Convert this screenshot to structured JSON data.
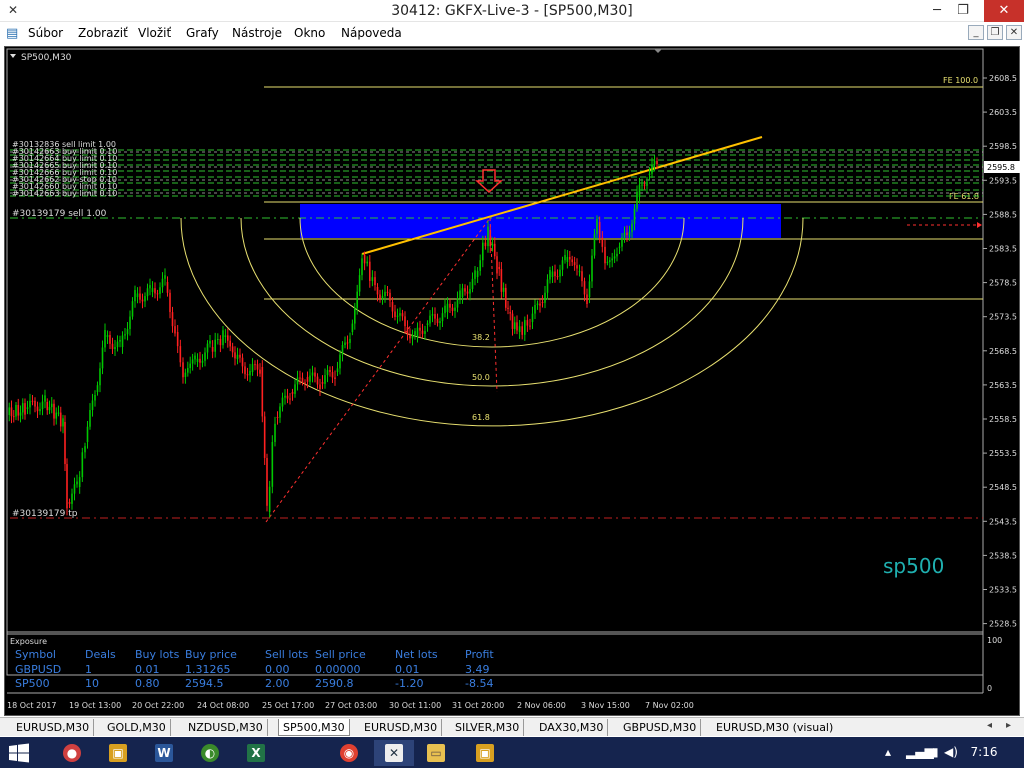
{
  "window": {
    "title": "30412: GKFX-Live-3 - [SP500,M30]",
    "minimize": "─",
    "maximize": "❐",
    "close": "✕"
  },
  "menu": {
    "items": [
      "Súbor",
      "Zobraziť",
      "Vložiť",
      "Grafy",
      "Nástroje",
      "Okno",
      "Nápoveda"
    ]
  },
  "chart": {
    "label": "SP500,M30",
    "watermark": "sp500",
    "price_marker": "2595.8",
    "price_ticks": [
      "2608.5",
      "2603.5",
      "2598.5",
      "2593.5",
      "2588.5",
      "2583.5",
      "2578.5",
      "2573.5",
      "2568.5",
      "2563.5",
      "2558.5",
      "2553.5",
      "2548.5",
      "2543.5",
      "2538.5",
      "2533.5",
      "2528.5"
    ],
    "time_ticks": [
      "18 Oct 2017",
      "19 Oct 13:00",
      "20 Oct 22:00",
      "24 Oct 08:00",
      "25 Oct 17:00",
      "27 Oct 03:00",
      "30 Oct 11:00",
      "31 Oct 20:00",
      "2 Nov 06:00",
      "3 Nov 15:00",
      "7 Nov 02:00"
    ],
    "fib_labels": {
      "fe100": "FE 100.0",
      "fe618": "FE 61.8",
      "arc382": "38.2",
      "arc500": "50.0",
      "arc618": "61.8"
    },
    "order_labels": {
      "sell": "#30139179 sell 1.00",
      "tp": "#30139179 tp",
      "buy_block": [
        "#30132836 sell limit 1.00",
        "#30142663 buy limit 0.10",
        "#30142664 buy limit 0.10",
        "#30142665 buy limit 0.10",
        "#30142666 buy limit 0.10",
        "#30142662 buy stop 0.10",
        "#30142660 buy limit 0.10",
        "#30142663 buy limit 0.10"
      ]
    },
    "colors": {
      "bull": "#00c800",
      "bear": "#ff2020",
      "fib": "#e8e070",
      "trend": "#ffc000",
      "zone": "#0000ff",
      "watermark": "#1fb0b0"
    }
  },
  "exposure": {
    "title": "Exposure",
    "headers": [
      "Symbol",
      "Deals",
      "Buy lots",
      "Buy price",
      "Sell lots",
      "Sell price",
      "Net lots",
      "Profit"
    ],
    "rows": [
      [
        "GBPUSD",
        "1",
        "0.01",
        "1.31265",
        "0.00",
        "0.00000",
        "0.01",
        "3.49"
      ],
      [
        "SP500",
        "10",
        "0.80",
        "2594.5",
        "2.00",
        "2590.8",
        "-1.20",
        "-8.54"
      ]
    ],
    "scale_top": "100",
    "scale_bottom": "0"
  },
  "tabs": [
    "EURUSD,M30",
    "GOLD,M30",
    "NZDUSD,M30",
    "SP500,M30",
    "EURUSD,M30",
    "SILVER,M30",
    "DAX30,M30",
    "GBPUSD,M30",
    "EURUSD,M30 (visual)"
  ],
  "active_tab": "SP500,M30",
  "taskbar": {
    "apps": [
      "paint-icon",
      "app-icon",
      "word-icon",
      "mt4-icon",
      "excel-icon",
      "chrome-icon",
      "mt4-active-icon",
      "explorer-icon",
      "app2-icon"
    ],
    "clock": "7:16"
  }
}
